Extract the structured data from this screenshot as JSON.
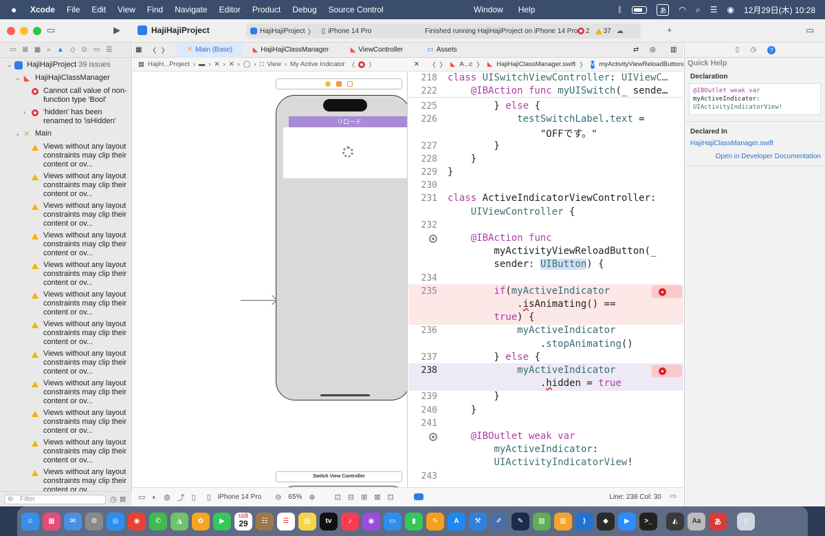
{
  "menubar": {
    "app": "Xcode",
    "items": [
      "File",
      "Edit",
      "View",
      "Find",
      "Navigate",
      "Editor",
      "Product",
      "Debug",
      "Source Control"
    ],
    "right_menus": [
      "Window",
      "Help"
    ],
    "input_mode": "あ",
    "datetime": "12月29日(木) 10:28"
  },
  "toolbar": {
    "project": "HajiHajiProject",
    "scheme": "HajiHajiProject",
    "device": "iPhone 14 Pro",
    "status": "Finished running HajiHajiProject on iPhone 14 Pro",
    "error_count": "2",
    "warning_count": "37"
  },
  "navigator": {
    "project": "HajiHajiProject",
    "project_issues": "39 issues",
    "group1": "HajiHajiClassManager",
    "errors": [
      "Cannot call value of non-function type 'Bool'",
      "'hidden' has been renamed to 'isHidden'"
    ],
    "group2": "Main",
    "warning_text": "Views without any layout constraints may clip their content or ov...",
    "warning_count_rows": 12,
    "filter_placeholder": "Filter"
  },
  "tabs": [
    {
      "label": "Main (Base)",
      "active": true
    },
    {
      "label": "HajiHajiClassManager",
      "active": false
    },
    {
      "label": "ViewController",
      "active": false
    },
    {
      "label": "Assets",
      "active": false
    }
  ],
  "canvas": {
    "jump_project": "HajiH...Project",
    "jump_view": "View",
    "jump_item": "My Active Indicator",
    "reload_label": "リロード",
    "scene2_label": "Switch View Controller",
    "device": "iPhone 14 Pro",
    "zoom": "65%"
  },
  "code_jump": {
    "first": "A...c",
    "file": "HajiHajiClassManager.swift",
    "symbol": "myActivityViewReloadButton(_:)"
  },
  "code": {
    "sticky": [
      {
        "n": "218",
        "html": "class UISwitchViewController: UIViewC…"
      },
      {
        "n": "222",
        "html": "    @IBAction func myUISwitch(_ sende…"
      }
    ],
    "lines": [
      {
        "n": "225",
        "text": "        } else {"
      },
      {
        "n": "226",
        "text": "            testSwitchLabel.text ="
      },
      {
        "n": "",
        "text": "                \"OFFです。\""
      },
      {
        "n": "227",
        "text": "        }"
      },
      {
        "n": "228",
        "text": "    }"
      },
      {
        "n": "229",
        "text": "}"
      },
      {
        "n": "230",
        "text": ""
      },
      {
        "n": "231",
        "text": "class ActiveIndicatorViewController:"
      },
      {
        "n": "",
        "text": "    UIViewController {"
      },
      {
        "n": "232",
        "text": ""
      },
      {
        "n": "",
        "text": "    @IBAction func"
      },
      {
        "n": "",
        "text": "        myActivityViewReloadButton(_"
      },
      {
        "n": "",
        "text": "        sender: UIButton) {"
      },
      {
        "n": "234",
        "text": ""
      },
      {
        "n": "235",
        "text": "        if(myActiveIndicator"
      },
      {
        "n": "",
        "text": "            .isAnimating() =="
      },
      {
        "n": "",
        "text": "        true) {"
      },
      {
        "n": "236",
        "text": "            myActiveIndicator"
      },
      {
        "n": "",
        "text": "                .stopAnimating()"
      },
      {
        "n": "237",
        "text": "        } else {"
      },
      {
        "n": "238",
        "text": "            myActiveIndicator"
      },
      {
        "n": "",
        "text": "                .hidden = true"
      },
      {
        "n": "239",
        "text": "        }"
      },
      {
        "n": "240",
        "text": "    }"
      },
      {
        "n": "241",
        "text": ""
      },
      {
        "n": "",
        "text": "    @IBOutlet weak var"
      },
      {
        "n": "",
        "text": "        myActiveIndicator:"
      },
      {
        "n": "",
        "text": "        UIActivityIndicatorView!"
      },
      {
        "n": "243",
        "text": ""
      }
    ],
    "status": "Line: 238  Col: 30"
  },
  "inspector": {
    "title": "Quick Help",
    "declaration_heading": "Declaration",
    "declaration": "@IBOutlet weak var\nmyActiveIndicator:\nUIActivityIndicatorView!",
    "declared_in_heading": "Declared In",
    "declared_in": "HajiHajiClassManager.swift",
    "link": "Open in Developer Documentation"
  },
  "dock": {
    "calendar_month": "12月",
    "calendar_day": "29"
  }
}
